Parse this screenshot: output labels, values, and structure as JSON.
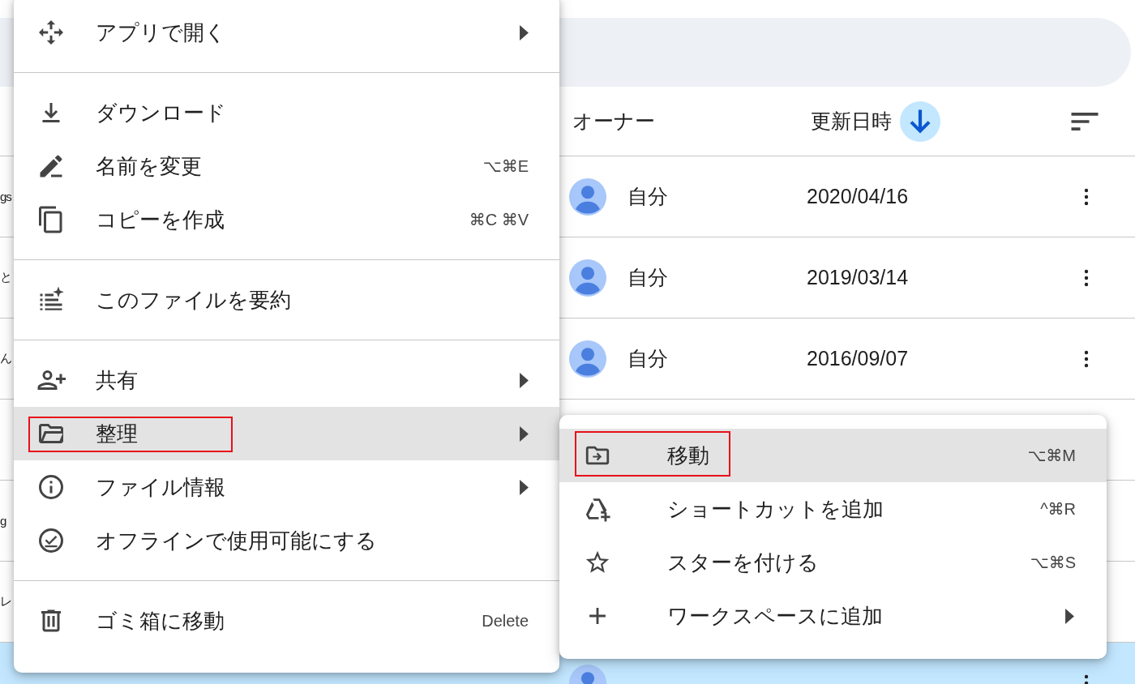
{
  "table": {
    "columns": [
      {
        "label": "オーナー",
        "sorted": false
      },
      {
        "label": "更新日時",
        "sorted": true
      }
    ],
    "rows": [
      {
        "name": "gs",
        "owner": "自分",
        "modified": "2020/04/16",
        "selected": false
      },
      {
        "name": "と",
        "owner": "自分",
        "modified": "2019/03/14",
        "selected": false
      },
      {
        "name": "ん",
        "owner": "自分",
        "modified": "2016/09/07",
        "selected": false
      },
      {
        "selected": false
      },
      {
        "name": "g",
        "selected": false
      },
      {
        "name": "レ",
        "selected": false
      },
      {
        "selected": true
      }
    ]
  },
  "context_menu": {
    "items": [
      {
        "kind": "item",
        "label": "アプリで開く",
        "has_submenu": true,
        "highlighted": false,
        "annotated": false
      },
      {
        "kind": "divider"
      },
      {
        "kind": "item",
        "label": "ダウンロード",
        "has_submenu": false,
        "highlighted": false,
        "annotated": false
      },
      {
        "kind": "item",
        "label": "名前を変更",
        "shortcut": "⌥⌘E",
        "has_submenu": false,
        "highlighted": false,
        "annotated": false
      },
      {
        "kind": "item",
        "label": "コピーを作成",
        "shortcut": "⌘C ⌘V",
        "has_submenu": false,
        "highlighted": false,
        "annotated": false
      },
      {
        "kind": "divider"
      },
      {
        "kind": "item",
        "label": "このファイルを要約",
        "has_submenu": false,
        "highlighted": false,
        "annotated": false
      },
      {
        "kind": "divider"
      },
      {
        "kind": "item",
        "label": "共有",
        "has_submenu": true,
        "highlighted": false,
        "annotated": false
      },
      {
        "kind": "item",
        "label": "整理",
        "has_submenu": true,
        "highlighted": true,
        "annotated": true
      },
      {
        "kind": "item",
        "label": "ファイル情報",
        "has_submenu": true,
        "highlighted": false,
        "annotated": false
      },
      {
        "kind": "item",
        "label": "オフラインで使用可能にする",
        "has_submenu": false,
        "highlighted": false,
        "annotated": false
      },
      {
        "kind": "divider"
      },
      {
        "kind": "item",
        "label": "ゴミ箱に移動",
        "shortcut": "Delete",
        "has_submenu": false,
        "highlighted": false,
        "annotated": false
      }
    ]
  },
  "submenu": {
    "items": [
      {
        "kind": "item",
        "label": "移動",
        "shortcut": "⌥⌘M",
        "has_submenu": false,
        "highlighted": true,
        "annotated": true
      },
      {
        "kind": "item",
        "label": "ショートカットを追加",
        "shortcut": "^⌘R",
        "has_submenu": false,
        "highlighted": false,
        "annotated": false
      },
      {
        "kind": "item",
        "label": "スターを付ける",
        "shortcut": "⌥⌘S",
        "has_submenu": false,
        "highlighted": false,
        "annotated": false
      },
      {
        "kind": "item",
        "label": "ワークスペースに追加",
        "has_submenu": true,
        "highlighted": false,
        "annotated": false
      }
    ]
  }
}
